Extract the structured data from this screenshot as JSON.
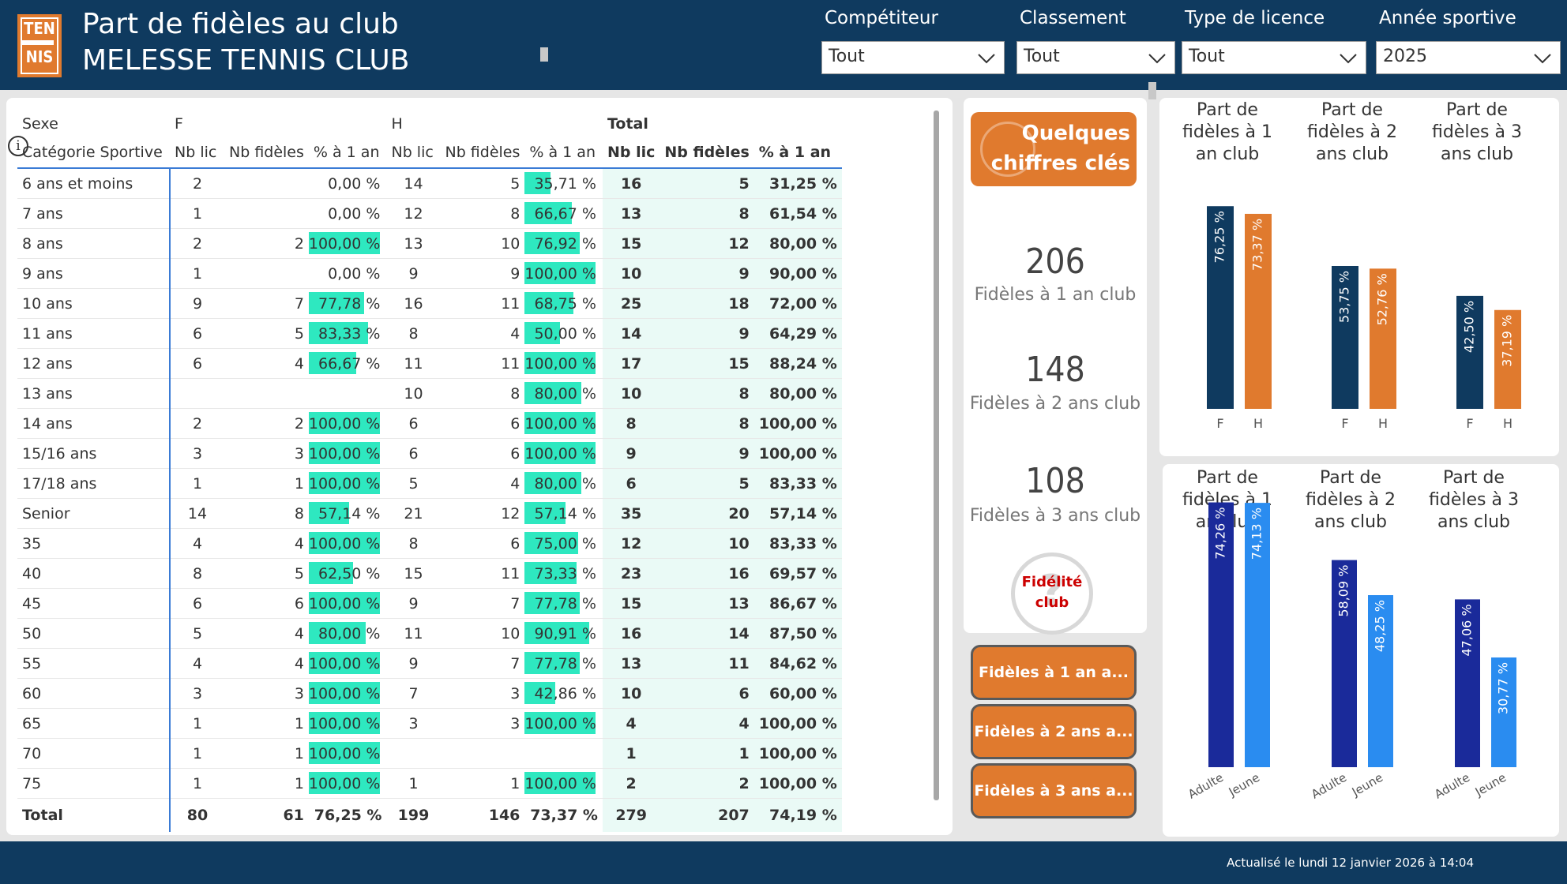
{
  "header": {
    "title": "Part de fidèles au club",
    "club": "MELESSE TENNIS CLUB",
    "logo_text_top": "TEN",
    "logo_text_bottom": "NIS"
  },
  "filters": [
    {
      "label": "Compétiteur",
      "value": "Tout"
    },
    {
      "label": "Classement",
      "value": "Tout"
    },
    {
      "label": "Type de licence",
      "value": "Tout"
    },
    {
      "label": "Année sportive",
      "value": "2025"
    }
  ],
  "table": {
    "group_row": {
      "label": "Sexe",
      "f": "F",
      "h": "H",
      "total": "Total"
    },
    "columns": [
      "Catégorie Sportive",
      "Nb lic",
      "Nb fidèles",
      "% à 1 an",
      "Nb lic",
      "Nb fidèles",
      "% à 1 an",
      "Nb lic",
      "Nb fidèles",
      "% à 1 an"
    ],
    "rows": [
      {
        "cat": "6 ans et moins",
        "f_lic": "2",
        "f_fid": "",
        "f_pct": "0,00 %",
        "f_v": 0,
        "h_lic": "14",
        "h_fid": "5",
        "h_pct": "35,71 %",
        "h_v": 35.71,
        "t_lic": "16",
        "t_fid": "5",
        "t_pct": "31,25 %"
      },
      {
        "cat": "7 ans",
        "f_lic": "1",
        "f_fid": "",
        "f_pct": "0,00 %",
        "f_v": 0,
        "h_lic": "12",
        "h_fid": "8",
        "h_pct": "66,67 %",
        "h_v": 66.67,
        "t_lic": "13",
        "t_fid": "8",
        "t_pct": "61,54 %"
      },
      {
        "cat": "8 ans",
        "f_lic": "2",
        "f_fid": "2",
        "f_pct": "100,00 %",
        "f_v": 100,
        "h_lic": "13",
        "h_fid": "10",
        "h_pct": "76,92 %",
        "h_v": 76.92,
        "t_lic": "15",
        "t_fid": "12",
        "t_pct": "80,00 %"
      },
      {
        "cat": "9 ans",
        "f_lic": "1",
        "f_fid": "",
        "f_pct": "0,00 %",
        "f_v": 0,
        "h_lic": "9",
        "h_fid": "9",
        "h_pct": "100,00 %",
        "h_v": 100,
        "t_lic": "10",
        "t_fid": "9",
        "t_pct": "90,00 %"
      },
      {
        "cat": "10 ans",
        "f_lic": "9",
        "f_fid": "7",
        "f_pct": "77,78 %",
        "f_v": 77.78,
        "h_lic": "16",
        "h_fid": "11",
        "h_pct": "68,75 %",
        "h_v": 68.75,
        "t_lic": "25",
        "t_fid": "18",
        "t_pct": "72,00 %"
      },
      {
        "cat": "11 ans",
        "f_lic": "6",
        "f_fid": "5",
        "f_pct": "83,33 %",
        "f_v": 83.33,
        "h_lic": "8",
        "h_fid": "4",
        "h_pct": "50,00 %",
        "h_v": 50,
        "t_lic": "14",
        "t_fid": "9",
        "t_pct": "64,29 %"
      },
      {
        "cat": "12 ans",
        "f_lic": "6",
        "f_fid": "4",
        "f_pct": "66,67 %",
        "f_v": 66.67,
        "h_lic": "11",
        "h_fid": "11",
        "h_pct": "100,00 %",
        "h_v": 100,
        "t_lic": "17",
        "t_fid": "15",
        "t_pct": "88,24 %"
      },
      {
        "cat": "13 ans",
        "f_lic": "",
        "f_fid": "",
        "f_pct": "",
        "f_v": null,
        "h_lic": "10",
        "h_fid": "8",
        "h_pct": "80,00 %",
        "h_v": 80,
        "t_lic": "10",
        "t_fid": "8",
        "t_pct": "80,00 %"
      },
      {
        "cat": "14 ans",
        "f_lic": "2",
        "f_fid": "2",
        "f_pct": "100,00 %",
        "f_v": 100,
        "h_lic": "6",
        "h_fid": "6",
        "h_pct": "100,00 %",
        "h_v": 100,
        "t_lic": "8",
        "t_fid": "8",
        "t_pct": "100,00 %"
      },
      {
        "cat": "15/16 ans",
        "f_lic": "3",
        "f_fid": "3",
        "f_pct": "100,00 %",
        "f_v": 100,
        "h_lic": "6",
        "h_fid": "6",
        "h_pct": "100,00 %",
        "h_v": 100,
        "t_lic": "9",
        "t_fid": "9",
        "t_pct": "100,00 %"
      },
      {
        "cat": "17/18 ans",
        "f_lic": "1",
        "f_fid": "1",
        "f_pct": "100,00 %",
        "f_v": 100,
        "h_lic": "5",
        "h_fid": "4",
        "h_pct": "80,00 %",
        "h_v": 80,
        "t_lic": "6",
        "t_fid": "5",
        "t_pct": "83,33 %"
      },
      {
        "cat": "Senior",
        "f_lic": "14",
        "f_fid": "8",
        "f_pct": "57,14 %",
        "f_v": 57.14,
        "h_lic": "21",
        "h_fid": "12",
        "h_pct": "57,14 %",
        "h_v": 57.14,
        "t_lic": "35",
        "t_fid": "20",
        "t_pct": "57,14 %"
      },
      {
        "cat": "35",
        "f_lic": "4",
        "f_fid": "4",
        "f_pct": "100,00 %",
        "f_v": 100,
        "h_lic": "8",
        "h_fid": "6",
        "h_pct": "75,00 %",
        "h_v": 75,
        "t_lic": "12",
        "t_fid": "10",
        "t_pct": "83,33 %"
      },
      {
        "cat": "40",
        "f_lic": "8",
        "f_fid": "5",
        "f_pct": "62,50 %",
        "f_v": 62.5,
        "h_lic": "15",
        "h_fid": "11",
        "h_pct": "73,33 %",
        "h_v": 73.33,
        "t_lic": "23",
        "t_fid": "16",
        "t_pct": "69,57 %"
      },
      {
        "cat": "45",
        "f_lic": "6",
        "f_fid": "6",
        "f_pct": "100,00 %",
        "f_v": 100,
        "h_lic": "9",
        "h_fid": "7",
        "h_pct": "77,78 %",
        "h_v": 77.78,
        "t_lic": "15",
        "t_fid": "13",
        "t_pct": "86,67 %"
      },
      {
        "cat": "50",
        "f_lic": "5",
        "f_fid": "4",
        "f_pct": "80,00 %",
        "f_v": 80,
        "h_lic": "11",
        "h_fid": "10",
        "h_pct": "90,91 %",
        "h_v": 90.91,
        "t_lic": "16",
        "t_fid": "14",
        "t_pct": "87,50 %"
      },
      {
        "cat": "55",
        "f_lic": "4",
        "f_fid": "4",
        "f_pct": "100,00 %",
        "f_v": 100,
        "h_lic": "9",
        "h_fid": "7",
        "h_pct": "77,78 %",
        "h_v": 77.78,
        "t_lic": "13",
        "t_fid": "11",
        "t_pct": "84,62 %"
      },
      {
        "cat": "60",
        "f_lic": "3",
        "f_fid": "3",
        "f_pct": "100,00 %",
        "f_v": 100,
        "h_lic": "7",
        "h_fid": "3",
        "h_pct": "42,86 %",
        "h_v": 42.86,
        "t_lic": "10",
        "t_fid": "6",
        "t_pct": "60,00 %"
      },
      {
        "cat": "65",
        "f_lic": "1",
        "f_fid": "1",
        "f_pct": "100,00 %",
        "f_v": 100,
        "h_lic": "3",
        "h_fid": "3",
        "h_pct": "100,00 %",
        "h_v": 100,
        "t_lic": "4",
        "t_fid": "4",
        "t_pct": "100,00 %"
      },
      {
        "cat": "70",
        "f_lic": "1",
        "f_fid": "1",
        "f_pct": "100,00 %",
        "f_v": 100,
        "h_lic": "",
        "h_fid": "",
        "h_pct": "",
        "h_v": null,
        "t_lic": "1",
        "t_fid": "1",
        "t_pct": "100,00 %"
      },
      {
        "cat": "75",
        "f_lic": "1",
        "f_fid": "1",
        "f_pct": "100,00 %",
        "f_v": 100,
        "h_lic": "1",
        "h_fid": "1",
        "h_pct": "100,00 %",
        "h_v": 100,
        "t_lic": "2",
        "t_fid": "2",
        "t_pct": "100,00 %"
      }
    ],
    "total": {
      "cat": "Total",
      "f_lic": "80",
      "f_fid": "61",
      "f_pct": "76,25 %",
      "h_lic": "199",
      "h_fid": "146",
      "h_pct": "73,37 %",
      "t_lic": "279",
      "t_fid": "207",
      "t_pct": "74,19 %"
    }
  },
  "key_figures": {
    "button_line1": "Quelques",
    "button_line2": "chiffres clés",
    "kpis": [
      {
        "value": "206",
        "label": "Fidèles à 1 an club"
      },
      {
        "value": "148",
        "label": "Fidèles à 2 ans club"
      },
      {
        "value": "108",
        "label": "Fidèles à 3 ans club"
      }
    ],
    "badge_line1": "Fidélité",
    "badge_line2": "club",
    "badge_mark": "?"
  },
  "nav_buttons": [
    "Fidèles à 1 an a...",
    "Fidèles à 2 ans a...",
    "Fidèles à 3 ans a..."
  ],
  "footer": {
    "updated": "Actualisé le lundi 12 janvier 2026 à 14:04"
  },
  "colors": {
    "navy": "#0f3a5f",
    "orange": "#e07a2e",
    "teal": "#2ee8c0",
    "dark_blue": "#1a2a9a",
    "light_blue": "#2a8cf0"
  },
  "chart_data": [
    {
      "type": "bar",
      "title": "Part de fidèles à 1 an club",
      "categories": [
        "F",
        "H"
      ],
      "values": [
        76.25,
        73.37
      ],
      "labels": [
        "76,25 %",
        "73,37 %"
      ]
    },
    {
      "type": "bar",
      "title": "Part de fidèles à 2 ans club",
      "categories": [
        "F",
        "H"
      ],
      "values": [
        53.75,
        52.76
      ],
      "labels": [
        "53,75 %",
        "52,76 %"
      ]
    },
    {
      "type": "bar",
      "title": "Part de fidèles à 3 ans club",
      "categories": [
        "F",
        "H"
      ],
      "values": [
        42.5,
        37.19
      ],
      "labels": [
        "42,50 %",
        "37,19 %"
      ]
    },
    {
      "type": "bar",
      "title": "Part de fidèles à 1 an club",
      "categories": [
        "Adulte",
        "Jeune"
      ],
      "values": [
        74.26,
        74.13
      ],
      "labels": [
        "74,26 %",
        "74,13 %"
      ]
    },
    {
      "type": "bar",
      "title": "Part de fidèles à 2 ans club",
      "categories": [
        "Adulte",
        "Jeune"
      ],
      "values": [
        58.09,
        48.25
      ],
      "labels": [
        "58,09 %",
        "48,25 %"
      ]
    },
    {
      "type": "bar",
      "title": "Part de fidèles à 3 ans club",
      "categories": [
        "Adulte",
        "Jeune"
      ],
      "values": [
        47.06,
        30.77
      ],
      "labels": [
        "47,06 %",
        "30,77 %"
      ]
    }
  ]
}
